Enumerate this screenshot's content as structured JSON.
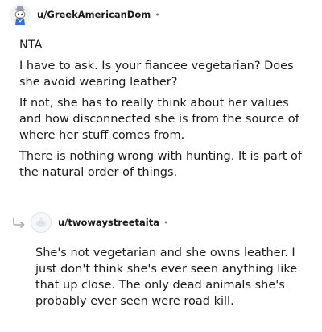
{
  "main_comment": {
    "username": "u/GreekAmericanDom",
    "separator": "•",
    "avatar_icon": "snoo-avatar-icon",
    "paragraphs": [
      "NTA",
      "I have to ask. Is your fiancee vegetarian? Does she avoid wearing leather?",
      "If not, she has to really think about her values and how disconnected she is from the source of where her stuff comes from.",
      "There is nothing wrong with hunting. It is part of the natural order of things."
    ]
  },
  "reply_comment": {
    "username": "u/twowaystreetaita",
    "separator": "•",
    "reply_icon": "reply-arrow-icon",
    "avatar_icon": "default-avatar-icon",
    "paragraphs": [
      "She's not vegetarian and she owns leather. I just don't think she's ever seen anything like that up close. The only dead animals she's probably ever seen were road kill."
    ]
  },
  "colors": {
    "text": "#1c1c1c",
    "meta": "#7c7c7c",
    "reply_arrow": "#a8aab0"
  }
}
